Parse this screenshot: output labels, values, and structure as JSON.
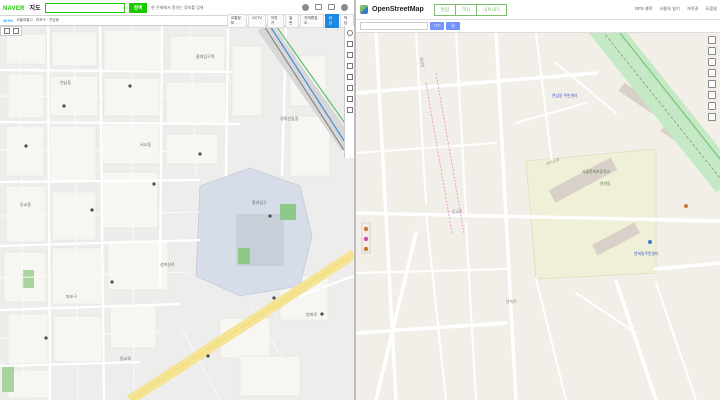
{
  "naver": {
    "logo": "NAVER",
    "service": "지도",
    "search_button": "검색",
    "search_hint": "한 주제에서 원하는 정보를 검색",
    "toolbar": {
      "zoom_level": "35.6%",
      "location": "서울특별시 · 마포구 · 연남동",
      "tabs": [
        "교통정보",
        "CCTV",
        "자전거",
        "일반",
        "지적편집도",
        "위성",
        "적당"
      ],
      "active_tab": "위성"
    },
    "map_labels": [
      "홍대입구역",
      "연남동",
      "경의선숲길",
      "서교동",
      "동교동",
      "홍대입구",
      "마포구",
      "성미산로",
      "동교로",
      "양화로"
    ]
  },
  "osm": {
    "title": "OpenStreetMap",
    "buttons": [
      "편집",
      "역사",
      "내보내기"
    ],
    "right_links": [
      "GPS 궤적",
      "사용자 일기",
      "저작권",
      "도움말"
    ],
    "search_button": "가기",
    "directions_label": "길",
    "map_labels": [
      {
        "text": "연남로",
        "color": "gray"
      },
      {
        "text": "동교로",
        "color": "gray"
      },
      {
        "text": "성미산로",
        "color": "gray"
      },
      {
        "text": "연남동 주민센터",
        "color": "blue"
      },
      {
        "text": "서울연희초등학교",
        "color": "green"
      },
      {
        "text": "연희동",
        "color": "green"
      },
      {
        "text": "연희동주민센터",
        "color": "blue"
      },
      {
        "text": "연희로",
        "color": "gray"
      }
    ]
  },
  "colors": {
    "naver_green": "#1ec800",
    "osm_green": "#7ebc6f",
    "osm_blue": "#7092ff",
    "rail_green": "#9cdba5"
  }
}
